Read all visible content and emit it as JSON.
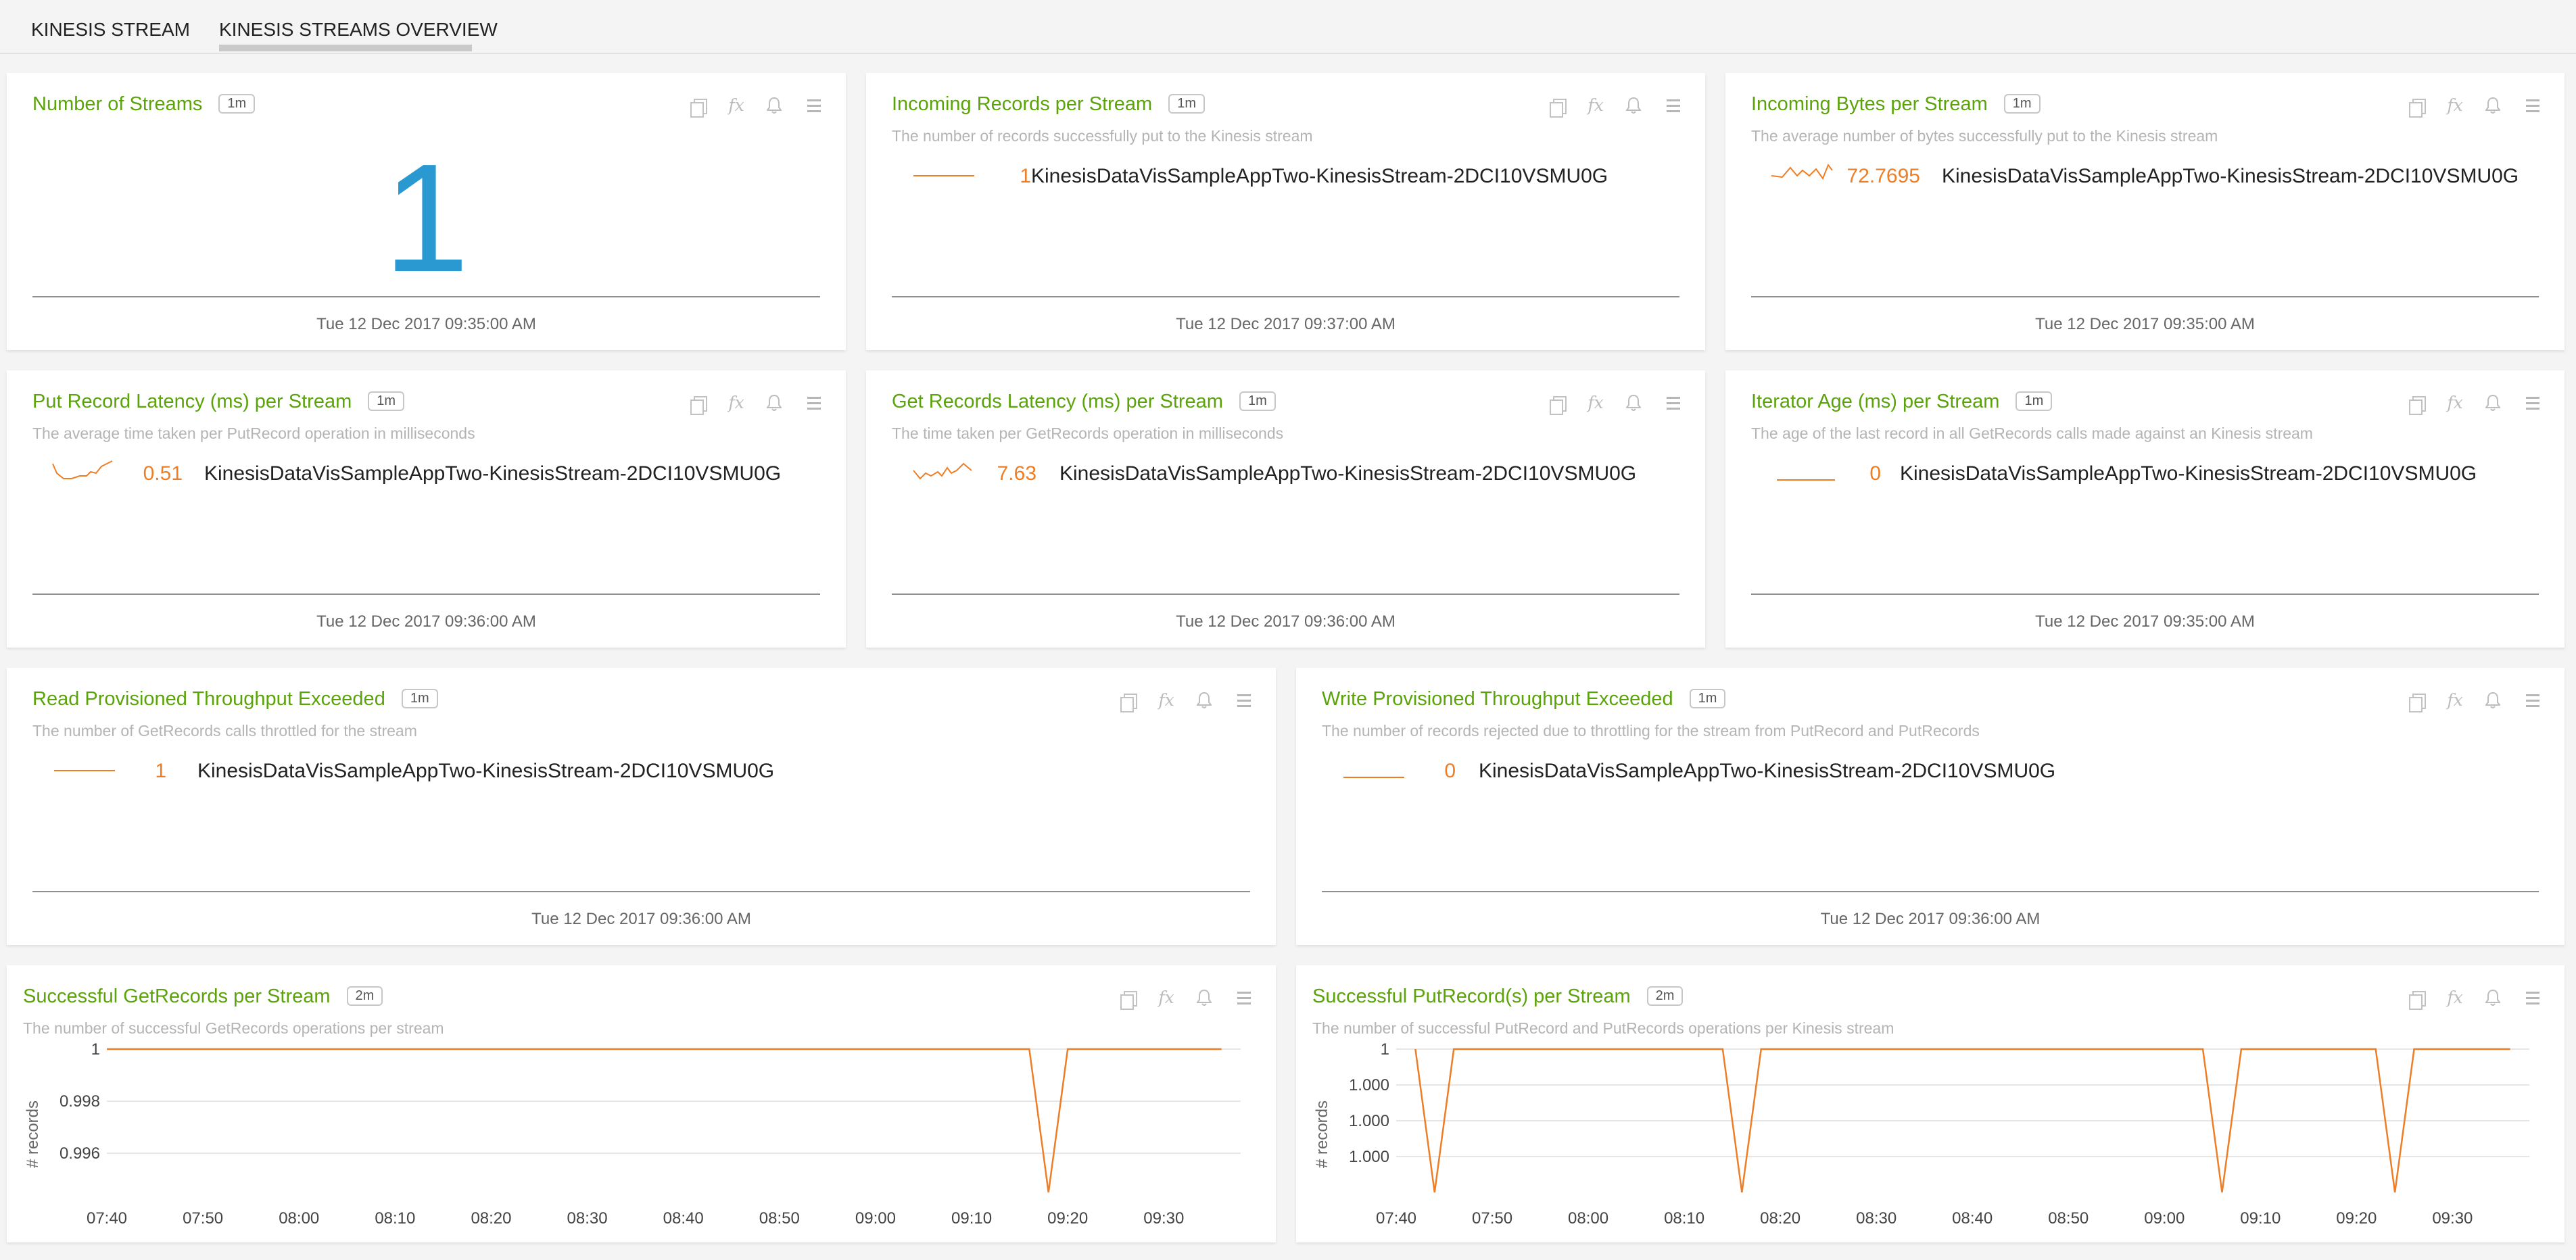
{
  "tabs": [
    {
      "label": "KINESIS STREAM",
      "active": false
    },
    {
      "label": "KINESIS STREAMS OVERVIEW",
      "active": true
    }
  ],
  "colors": {
    "title": "#5ba30a",
    "series": "#ee7e26",
    "big_number": "#2a99d2"
  },
  "icons": [
    "copy-icon",
    "fx-icon",
    "bell-icon",
    "menu-icon"
  ],
  "panels": {
    "num_streams": {
      "title": "Number of Streams",
      "badge": "1m",
      "value": "1",
      "timestamp": "Tue 12 Dec 2017 09:35:00 AM"
    },
    "incoming_records": {
      "title": "Incoming Records per Stream",
      "badge": "1m",
      "desc": "The number of records successfully put to the Kinesis stream",
      "value": "1",
      "name": "KinesisDataVisSampleAppTwo-KinesisStream-2DCI10VSMU0G",
      "timestamp": "Tue 12 Dec 2017 09:37:00 AM"
    },
    "incoming_bytes": {
      "title": "Incoming Bytes per Stream",
      "badge": "1m",
      "desc": "The average number of bytes successfully put to the Kinesis stream",
      "value": "72.7695",
      "name": "KinesisDataVisSampleAppTwo-KinesisStream-2DCI10VSMU0G",
      "timestamp": "Tue 12 Dec 2017 09:35:00 AM"
    },
    "put_latency": {
      "title": "Put Record Latency (ms) per Stream",
      "badge": "1m",
      "desc": "The average time taken per PutRecord operation in milliseconds",
      "value": "0.51",
      "name": "KinesisDataVisSampleAppTwo-KinesisStream-2DCI10VSMU0G",
      "timestamp": "Tue 12 Dec 2017 09:36:00 AM"
    },
    "get_latency": {
      "title": "Get Records Latency (ms) per Stream",
      "badge": "1m",
      "desc": "The time taken per GetRecords operation in milliseconds",
      "value": "7.63",
      "name": "KinesisDataVisSampleAppTwo-KinesisStream-2DCI10VSMU0G",
      "timestamp": "Tue 12 Dec 2017 09:36:00 AM"
    },
    "iterator_age": {
      "title": "Iterator Age (ms) per Stream",
      "badge": "1m",
      "desc": "The age of the last record in all GetRecords calls made against an Kinesis stream",
      "value": "0",
      "name": "KinesisDataVisSampleAppTwo-KinesisStream-2DCI10VSMU0G",
      "timestamp": "Tue 12 Dec 2017 09:35:00 AM"
    },
    "read_exceeded": {
      "title": "Read Provisioned Throughput Exceeded",
      "badge": "1m",
      "desc": "The number of GetRecords calls throttled for the stream",
      "value": "1",
      "name": "KinesisDataVisSampleAppTwo-KinesisStream-2DCI10VSMU0G",
      "timestamp": "Tue 12 Dec 2017 09:36:00 AM"
    },
    "write_exceeded": {
      "title": "Write Provisioned Throughput Exceeded",
      "badge": "1m",
      "desc": "The number of records rejected due to throttling for the stream from PutRecord and PutRecords",
      "value": "0",
      "name": "KinesisDataVisSampleAppTwo-KinesisStream-2DCI10VSMU0G",
      "timestamp": "Tue 12 Dec 2017 09:36:00 AM"
    },
    "get_success": {
      "title": "Successful GetRecords per Stream",
      "badge": "2m",
      "desc": "The number of successful GetRecords operations per stream"
    },
    "put_success": {
      "title": "Successful PutRecord(s) per Stream",
      "badge": "2m",
      "desc": "The number of successful PutRecord and PutRecords operations per Kinesis stream"
    }
  },
  "chart_data": [
    {
      "type": "line",
      "panel": "Successful GetRecords per Stream",
      "ylabel": "# records",
      "yticks": [
        "1",
        "0.998",
        "0.996"
      ],
      "ytick_values": [
        1,
        0.998,
        0.996
      ],
      "ylim": [
        0.9945,
        1.0
      ],
      "xticks": [
        "07:40",
        "07:50",
        "08:00",
        "08:10",
        "08:20",
        "08:30",
        "08:40",
        "08:50",
        "09:00",
        "09:10",
        "09:20",
        "09:30"
      ],
      "xlim": [
        "07:40",
        "09:38"
      ],
      "series": [
        {
          "points": [
            [
              "07:40",
              1
            ],
            [
              "09:16",
              1
            ],
            [
              "09:18",
              0.9945
            ],
            [
              "09:20",
              1
            ],
            [
              "09:36",
              1
            ]
          ]
        }
      ]
    },
    {
      "type": "line",
      "panel": "Successful PutRecord(s) per Stream",
      "ylabel": "# records",
      "yticks": [
        "1",
        "1.000",
        "1.000",
        "1.000"
      ],
      "ytick_values": [
        1.0,
        0.9995,
        0.999,
        0.9985
      ],
      "ylim": [
        0.998,
        1.0
      ],
      "xticks": [
        "07:40",
        "07:50",
        "08:00",
        "08:10",
        "08:20",
        "08:30",
        "08:40",
        "08:50",
        "09:00",
        "09:10",
        "09:20",
        "09:30"
      ],
      "xlim": [
        "07:40",
        "09:38"
      ],
      "series": [
        {
          "points": [
            [
              "07:42",
              1
            ],
            [
              "07:44",
              0.998
            ],
            [
              "07:46",
              1
            ],
            [
              "08:14",
              1
            ],
            [
              "08:16",
              0.998
            ],
            [
              "08:18",
              1
            ],
            [
              "09:04",
              1
            ],
            [
              "09:06",
              0.998
            ],
            [
              "09:08",
              1
            ],
            [
              "09:22",
              1
            ],
            [
              "09:24",
              0.998
            ],
            [
              "09:26",
              1
            ],
            [
              "09:36",
              1
            ]
          ]
        }
      ]
    }
  ]
}
